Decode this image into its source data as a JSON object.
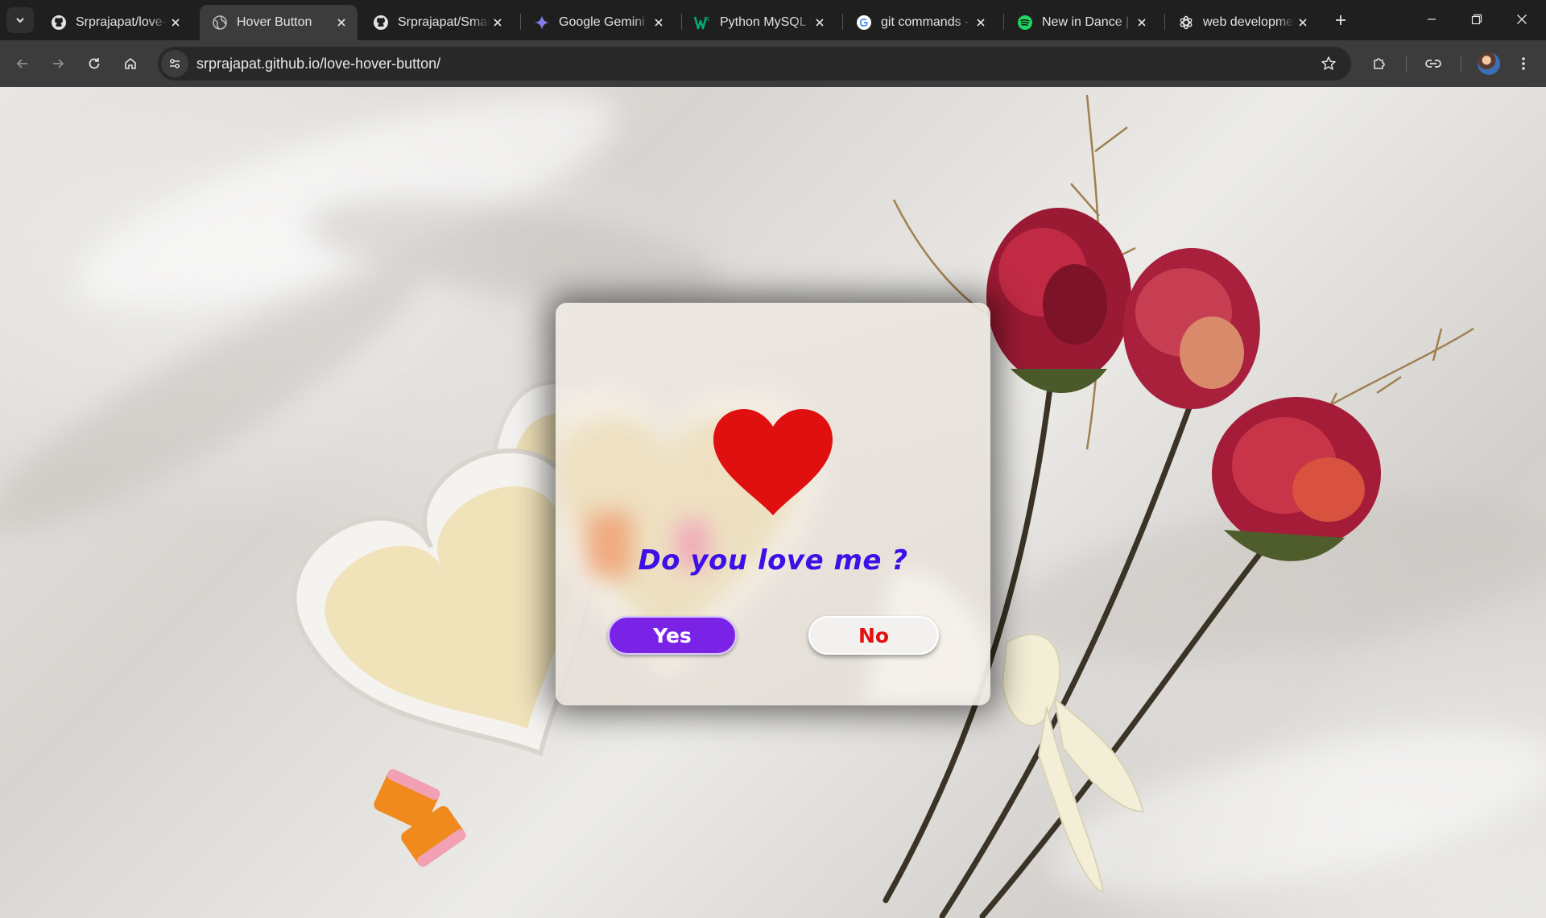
{
  "browser": {
    "tabs": [
      {
        "title": "Srprajapat/love-h",
        "icon": "github-icon",
        "active": false
      },
      {
        "title": "Hover Button",
        "icon": "globe-icon",
        "active": true
      },
      {
        "title": "Srprajapat/Smart",
        "icon": "github-icon",
        "active": false
      },
      {
        "title": "Google Gemini",
        "icon": "gemini-icon",
        "active": false
      },
      {
        "title": "Python MySQL C",
        "icon": "w3schools-icon",
        "active": false
      },
      {
        "title": "git commands -",
        "icon": "google-icon",
        "active": false
      },
      {
        "title": "New in Dance | S",
        "icon": "spotify-icon",
        "active": false
      },
      {
        "title": "web developmen",
        "icon": "openai-icon",
        "active": false
      }
    ],
    "url": "srprajapat.github.io/love-hover-button/"
  },
  "page": {
    "question": "Do you love me ?",
    "yes_label": "Yes",
    "no_label": "No",
    "colors": {
      "heart": "#e01010",
      "question": "#3c10e6",
      "yes_bg": "#7a22e6",
      "no_text": "#e0110f"
    }
  }
}
